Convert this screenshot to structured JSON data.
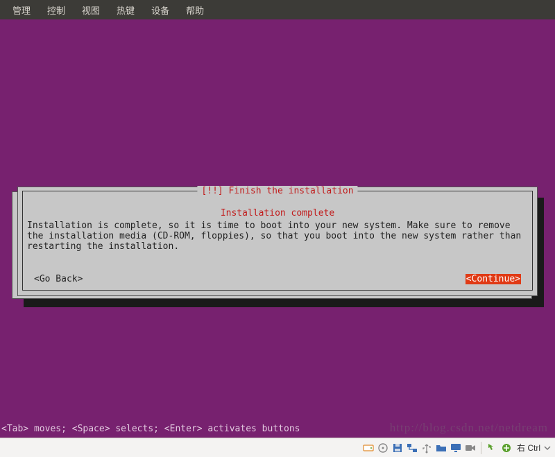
{
  "menubar": {
    "items": [
      "管理",
      "控制",
      "视图",
      "热键",
      "设备",
      "帮助"
    ]
  },
  "dialog": {
    "title": "[!!] Finish the installation",
    "subtitle": "Installation complete",
    "body": "Installation is complete, so it is time to boot into your new system. Make sure to remove the installation media (CD-ROM, floppies), so that you boot into the new system rather than restarting the installation.",
    "go_back": "<Go Back>",
    "continue": "<Continue>"
  },
  "hint": "<Tab> moves; <Space> selects; <Enter> activates buttons",
  "statusbar": {
    "hostkey": "右 Ctrl"
  },
  "watermark": "http://blog.csdn.net/netdream"
}
